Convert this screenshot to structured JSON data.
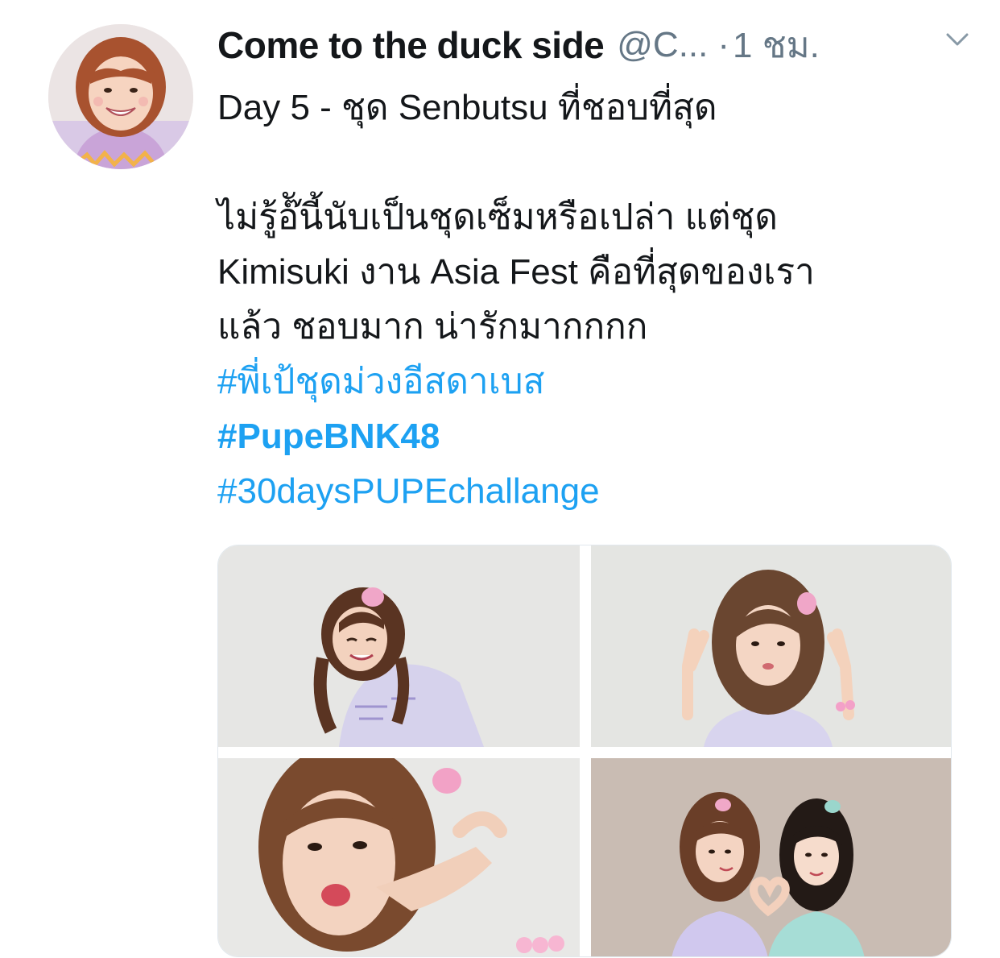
{
  "tweet": {
    "display_name": "Come to the duck side",
    "handle": "@C...",
    "separator": "·",
    "time": "1 ชม.",
    "lines": [
      "Day 5 -  ชุด Senbutsu ที่ชอบที่สุด",
      "",
      "ไม่รู้อ๊ันี้นับเป็นชุดเซ็มหรือเปล่า แต่ชุด",
      "Kimisuki งาน Asia Fest คือที่สุดของเรา",
      "แล้ว ชอบมาก น่ารักมากกกก"
    ],
    "hashtags": [
      "#พี่เป้ชุดม่วงอีสดาเบส",
      "#PupeBNK48",
      "#30daysPUPEchallange"
    ]
  },
  "icons": {
    "avatar": "profile-photo",
    "menu": "chevron-down-icon"
  },
  "colors": {
    "link": "#1da1f2",
    "text": "#14171a",
    "muted": "#657786"
  },
  "media": {
    "photo_count": 4
  }
}
